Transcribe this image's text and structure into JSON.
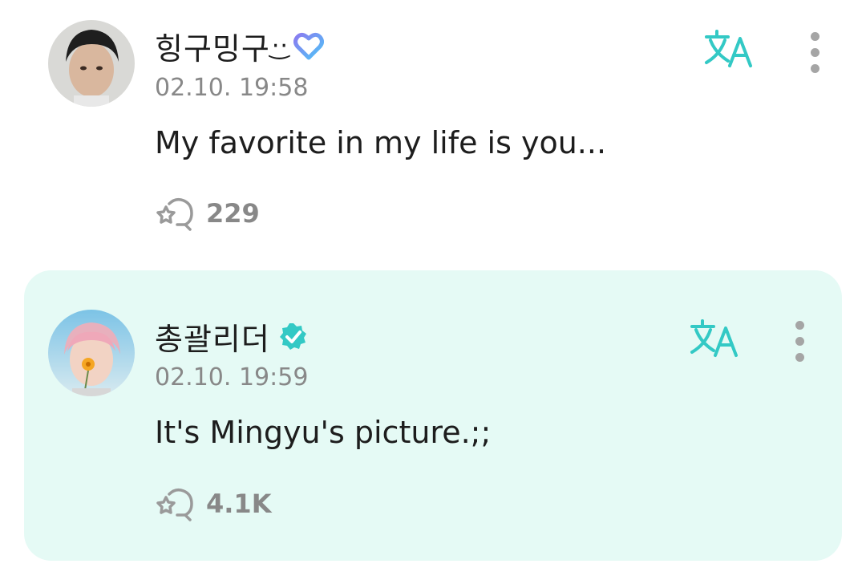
{
  "comments": [
    {
      "author": "힝구밍구",
      "author_suffix": "·͜·",
      "badge_icon": "heart-badge-icon",
      "timestamp": "02.10. 19:58",
      "text": "My favorite in my life is you...",
      "like_count": "229",
      "highlighted": false
    },
    {
      "author": "총괄리더",
      "badge_icon": "verified-badge-icon",
      "timestamp": "02.10. 19:59",
      "text": "It's Mingyu's picture.;;",
      "like_count": "4.1K",
      "highlighted": true
    }
  ],
  "colors": {
    "accent": "#33c9c5",
    "highlight_bg": "#e5faf5",
    "badge_heart_from": "#8a7bf0",
    "badge_heart_to": "#4fc3f7",
    "muted": "#888888"
  }
}
